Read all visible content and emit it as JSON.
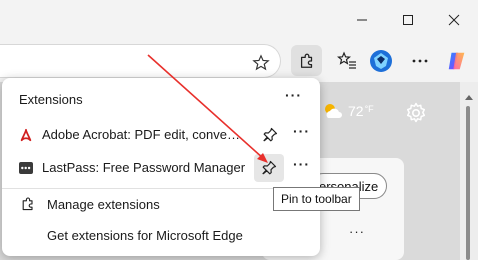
{
  "window": {
    "minimize_icon": "minimize-icon",
    "maximize_icon": "maximize-icon",
    "close_icon": "close-icon"
  },
  "toolbar": {
    "favorite_icon": "star-add-icon",
    "extensions_icon": "puzzle-icon",
    "favorites_icon": "favorites-list-icon",
    "profile_icon": "profile-avatar-icon",
    "more_icon": "more-icon",
    "copilot_icon": "copilot-icon"
  },
  "extensions_popup": {
    "title": "Extensions",
    "more": "···",
    "items": [
      {
        "label": "Adobe Acrobat: PDF edit, convert, si...",
        "icon": "adobe-acrobat-icon",
        "pin_icon": "pin-icon",
        "more": "···"
      },
      {
        "label": "LastPass: Free Password Manager",
        "icon": "lastpass-icon",
        "pin_icon": "pin-icon",
        "more": "···"
      }
    ],
    "manage_label": "Manage extensions",
    "get_label": "Get extensions for Microsoft Edge"
  },
  "tooltip": {
    "text": "Pin to toolbar"
  },
  "page": {
    "weather_temp": "72",
    "weather_unit": "°F",
    "personalize_label": "ersonalize",
    "card_more": "···"
  },
  "colors": {
    "annotation_arrow": "#e8302c",
    "adobe_red": "#d11f1f",
    "lastpass_dark": "#3a3a3a"
  }
}
